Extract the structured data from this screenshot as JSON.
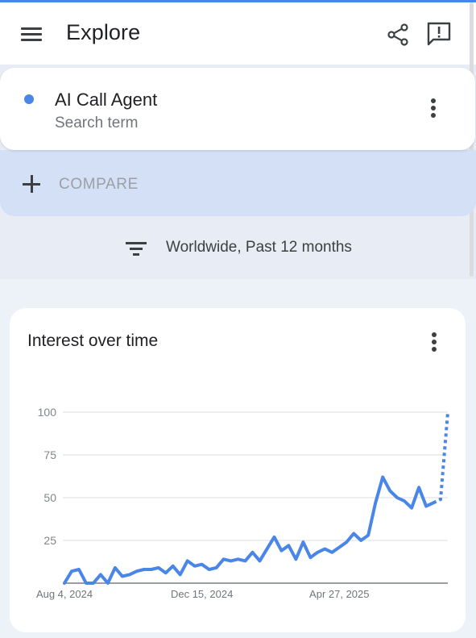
{
  "header": {
    "title": "Explore",
    "menu_icon": "menu-icon",
    "share_icon": "share-icon",
    "feedback_icon": "feedback-icon"
  },
  "search_term": {
    "name": "AI Call Agent",
    "type": "Search term",
    "color": "#4a86e8"
  },
  "compare": {
    "label": "COMPARE"
  },
  "filter": {
    "text": "Worldwide, Past 12 months"
  },
  "chart_card": {
    "title": "Interest over time"
  },
  "chart_data": {
    "type": "line",
    "title": "Interest over time",
    "xlabel": "",
    "ylabel": "",
    "ylim": [
      0,
      100
    ],
    "yticks": [
      25,
      50,
      75,
      100
    ],
    "x_tick_labels": [
      {
        "label": "Aug 4, 2024",
        "index": 0
      },
      {
        "label": "Dec 15, 2024",
        "index": 19
      },
      {
        "label": "Apr 27, 2025",
        "index": 38
      }
    ],
    "color": "#4a86e8",
    "series": [
      {
        "values": [
          0,
          7,
          8,
          0,
          0,
          5,
          0,
          9,
          4,
          5,
          7,
          8,
          8,
          9,
          6,
          10,
          5,
          13,
          10,
          11,
          8,
          9,
          14,
          13,
          14,
          13,
          18,
          13,
          20,
          27,
          19,
          22,
          14,
          24,
          15,
          18,
          20,
          18,
          21,
          24,
          29,
          25,
          28,
          47,
          62,
          54,
          50,
          48,
          44,
          56,
          45,
          47,
          49,
          100
        ],
        "partial_from_index": 51
      }
    ]
  }
}
